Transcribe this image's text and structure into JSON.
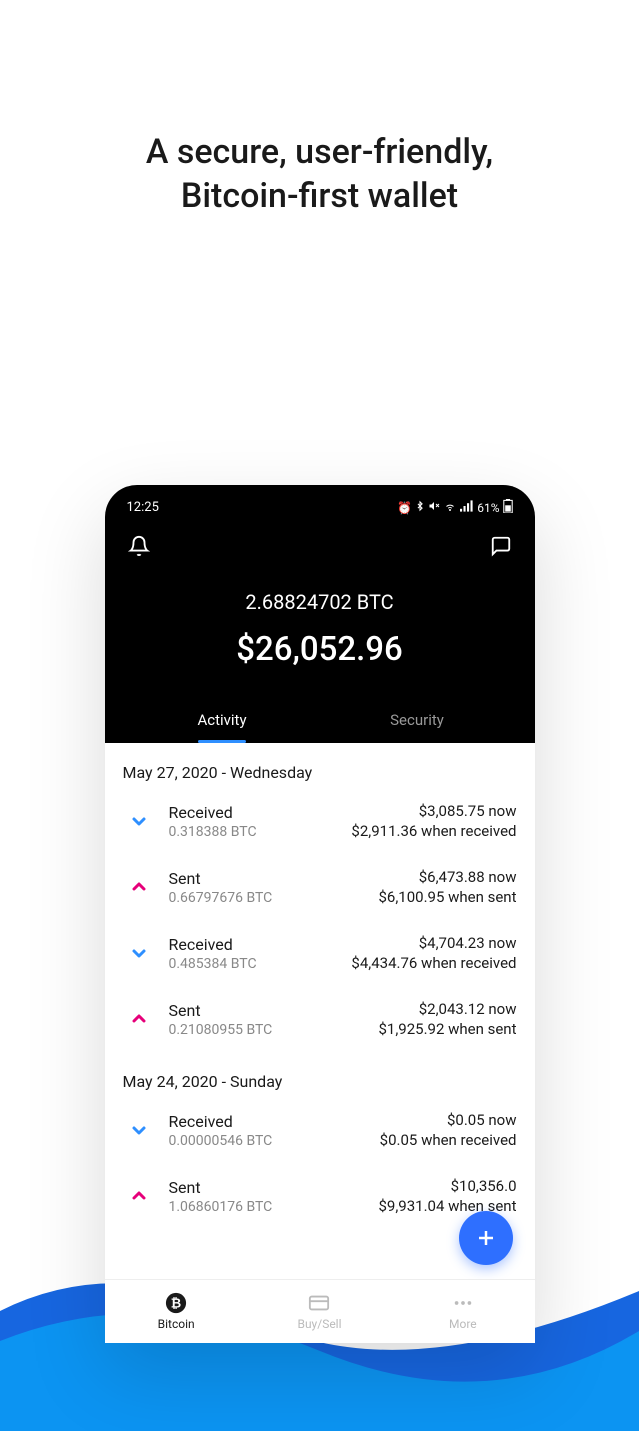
{
  "hero": {
    "line1": "A secure, user-friendly,",
    "line2": "Bitcoin-first wallet"
  },
  "status": {
    "time": "12:25",
    "battery": "61%"
  },
  "balance": {
    "btc": "2.68824702 BTC",
    "usd": "$26,052.96"
  },
  "tabs": {
    "activity": "Activity",
    "security": "Security"
  },
  "groups": [
    {
      "date": "May 27, 2020 - Wednesday",
      "txs": [
        {
          "type": "Received",
          "amount": "0.318388 BTC",
          "now": "$3,085.75 now",
          "then": "$2,911.36 when received",
          "dir": "down"
        },
        {
          "type": "Sent",
          "amount": "0.66797676 BTC",
          "now": "$6,473.88 now",
          "then": "$6,100.95 when sent",
          "dir": "up"
        },
        {
          "type": "Received",
          "amount": "0.485384 BTC",
          "now": "$4,704.23 now",
          "then": "$4,434.76 when received",
          "dir": "down"
        },
        {
          "type": "Sent",
          "amount": "0.21080955 BTC",
          "now": "$2,043.12 now",
          "then": "$1,925.92 when sent",
          "dir": "up"
        }
      ]
    },
    {
      "date": "May 24, 2020 - Sunday",
      "txs": [
        {
          "type": "Received",
          "amount": "0.00000546 BTC",
          "now": "$0.05 now",
          "then": "$0.05 when received",
          "dir": "down"
        },
        {
          "type": "Sent",
          "amount": "1.06860176 BTC",
          "now": "$10,356.0",
          "then": "$9,931.04 when sent",
          "dir": "up"
        }
      ]
    }
  ],
  "nav": {
    "bitcoin": "Bitcoin",
    "buysell": "Buy/Sell",
    "more": "More"
  }
}
